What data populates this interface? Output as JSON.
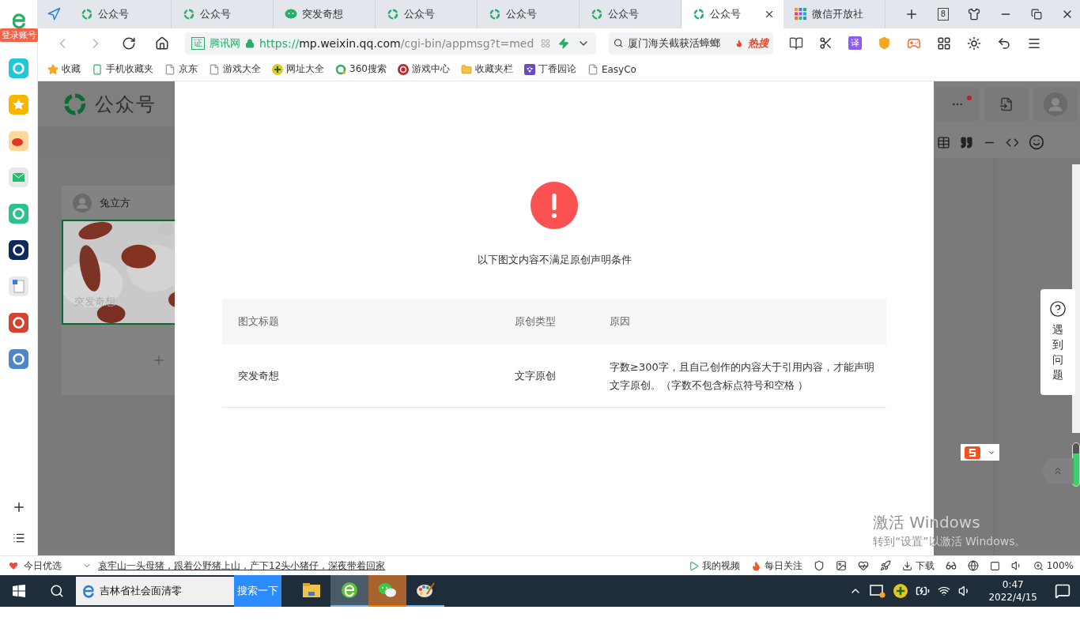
{
  "sidebar": {
    "login_label": "登录账号"
  },
  "tabs": [
    {
      "label": "公众号",
      "kind": "mp",
      "selected": false
    },
    {
      "label": "公众号",
      "kind": "mp",
      "selected": false
    },
    {
      "label": "突发奇想",
      "kind": "wechat",
      "selected": false
    },
    {
      "label": "公众号",
      "kind": "mp",
      "selected": false
    },
    {
      "label": "公众号",
      "kind": "mp",
      "selected": false
    },
    {
      "label": "公众号",
      "kind": "mp",
      "selected": false
    },
    {
      "label": "公众号",
      "kind": "mp",
      "selected": true
    },
    {
      "label": "微信开放社",
      "kind": "community",
      "selected": false
    }
  ],
  "tab_count": "8",
  "address_bar": {
    "site_badge": "证",
    "site_name": "腾讯网",
    "url_scheme": "https://",
    "url_host": "mp.weixin.qq.com",
    "url_path": "/cgi-bin/appmsg?t=med"
  },
  "search": {
    "placeholder": "厦门海关截获活蟑螂",
    "hot_label": "热搜"
  },
  "translate_label": "译",
  "bookmarks": [
    {
      "label": "收藏",
      "kind": "star"
    },
    {
      "label": "手机收藏夹",
      "kind": "phone"
    },
    {
      "label": "京东",
      "kind": "page"
    },
    {
      "label": "游戏大全",
      "kind": "page"
    },
    {
      "label": "网址大全",
      "kind": "plus"
    },
    {
      "label": "360搜索",
      "kind": "ring"
    },
    {
      "label": "游戏中心",
      "kind": "game"
    },
    {
      "label": "收藏夹栏",
      "kind": "folder"
    },
    {
      "label": "丁香园论",
      "kind": "flower"
    },
    {
      "label": "EasyCo",
      "kind": "page"
    }
  ],
  "page": {
    "logo": "公众号",
    "author": "兔立方",
    "article_title": "突发奇想",
    "more_badge": true
  },
  "dialog": {
    "message": "以下图文内容不满足原创声明条件",
    "columns": [
      "图文标题",
      "原创类型",
      "原因"
    ],
    "rows": [
      [
        "突发奇想",
        "文字原创",
        "字数≥300字，且自己创作的内容大于引用内容，才能声明文字原创。（字数不包含标点符号和空格 ）"
      ]
    ]
  },
  "help": {
    "label": "遇到问题"
  },
  "watermark": {
    "title": "激活 Windows",
    "subtitle": "转到“设置”以激活 Windows。"
  },
  "status_bar": {
    "today_label": "今日优选",
    "headline": "哀牢山一头母猪，跟着公野猪上山，产下12头小猪仔，深夜带着回家",
    "items": [
      {
        "label": "我的视频",
        "kind": "video"
      },
      {
        "label": "每日关注",
        "kind": "flame"
      }
    ],
    "download_label": "下载",
    "zoom": "100%"
  },
  "taskbar": {
    "search_value": "吉林省社会面清零",
    "search_button": "搜索一下",
    "apps": [
      {
        "kind": "explorer",
        "selected": false,
        "running": false,
        "flashing": false
      },
      {
        "kind": "browser",
        "selected": true,
        "running": true,
        "flashing": false
      },
      {
        "kind": "wechat",
        "selected": false,
        "running": true,
        "flashing": true
      },
      {
        "kind": "paint",
        "selected": false,
        "running": true,
        "flashing": false
      }
    ],
    "time": "0:47",
    "date": "2022/4/15"
  }
}
